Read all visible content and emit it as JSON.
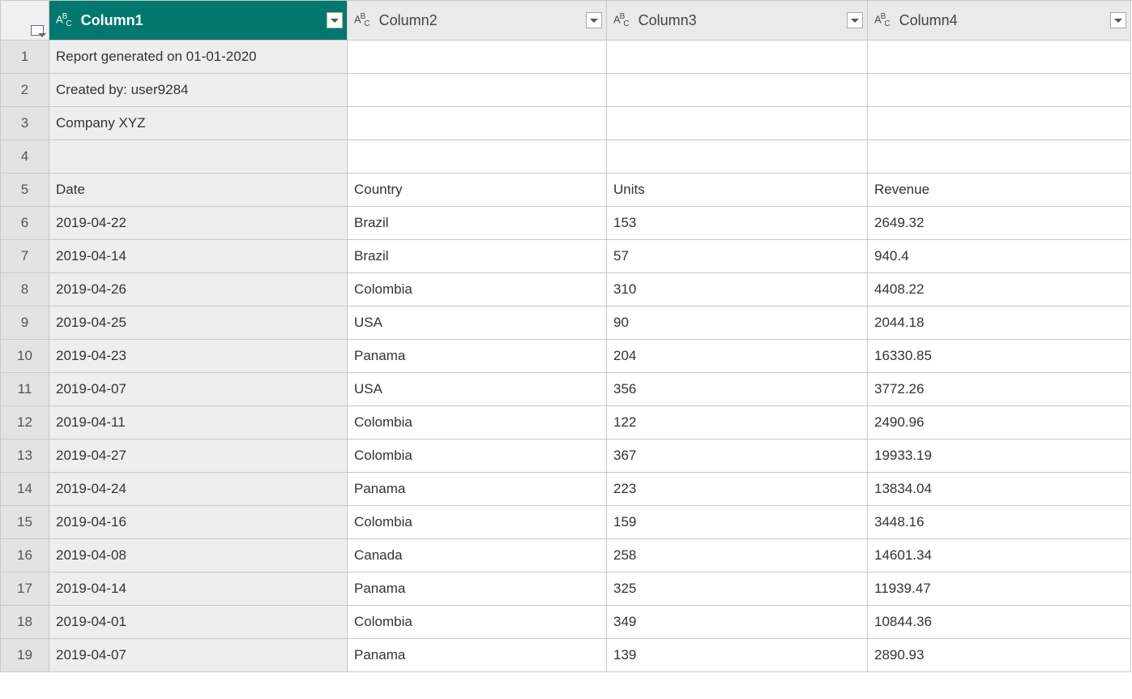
{
  "columns": [
    {
      "name": "Column1",
      "selected": true
    },
    {
      "name": "Column2",
      "selected": false
    },
    {
      "name": "Column3",
      "selected": false
    },
    {
      "name": "Column4",
      "selected": false
    }
  ],
  "type_label": "ABC",
  "rows": [
    {
      "n": "1",
      "c1": "Report generated on 01-01-2020",
      "c2": "",
      "c3": "",
      "c4": ""
    },
    {
      "n": "2",
      "c1": "Created by: user9284",
      "c2": "",
      "c3": "",
      "c4": ""
    },
    {
      "n": "3",
      "c1": "Company XYZ",
      "c2": "",
      "c3": "",
      "c4": ""
    },
    {
      "n": "4",
      "c1": "",
      "c2": "",
      "c3": "",
      "c4": ""
    },
    {
      "n": "5",
      "c1": "Date",
      "c2": "Country",
      "c3": "Units",
      "c4": "Revenue"
    },
    {
      "n": "6",
      "c1": "2019-04-22",
      "c2": "Brazil",
      "c3": "153",
      "c4": "2649.32"
    },
    {
      "n": "7",
      "c1": "2019-04-14",
      "c2": "Brazil",
      "c3": "57",
      "c4": "940.4"
    },
    {
      "n": "8",
      "c1": "2019-04-26",
      "c2": "Colombia",
      "c3": "310",
      "c4": "4408.22"
    },
    {
      "n": "9",
      "c1": "2019-04-25",
      "c2": "USA",
      "c3": "90",
      "c4": "2044.18"
    },
    {
      "n": "10",
      "c1": "2019-04-23",
      "c2": "Panama",
      "c3": "204",
      "c4": "16330.85"
    },
    {
      "n": "11",
      "c1": "2019-04-07",
      "c2": "USA",
      "c3": "356",
      "c4": "3772.26"
    },
    {
      "n": "12",
      "c1": "2019-04-11",
      "c2": "Colombia",
      "c3": "122",
      "c4": "2490.96"
    },
    {
      "n": "13",
      "c1": "2019-04-27",
      "c2": "Colombia",
      "c3": "367",
      "c4": "19933.19"
    },
    {
      "n": "14",
      "c1": "2019-04-24",
      "c2": "Panama",
      "c3": "223",
      "c4": "13834.04"
    },
    {
      "n": "15",
      "c1": "2019-04-16",
      "c2": "Colombia",
      "c3": "159",
      "c4": "3448.16"
    },
    {
      "n": "16",
      "c1": "2019-04-08",
      "c2": "Canada",
      "c3": "258",
      "c4": "14601.34"
    },
    {
      "n": "17",
      "c1": "2019-04-14",
      "c2": "Panama",
      "c3": "325",
      "c4": "11939.47"
    },
    {
      "n": "18",
      "c1": "2019-04-01",
      "c2": "Colombia",
      "c3": "349",
      "c4": "10844.36"
    },
    {
      "n": "19",
      "c1": "2019-04-07",
      "c2": "Panama",
      "c3": "139",
      "c4": "2890.93"
    }
  ]
}
